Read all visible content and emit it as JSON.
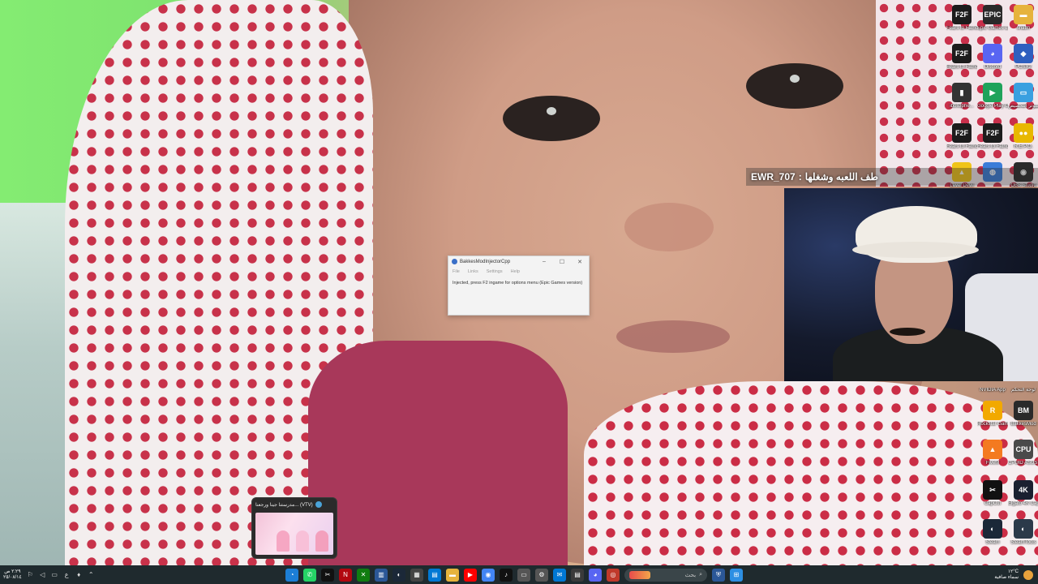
{
  "chat_overlay": {
    "username": "EWR_707",
    "separator": ":",
    "message": "طف اللعبه وشغلها"
  },
  "dialog": {
    "title": "BakkesModInjectorCpp",
    "minimize": "–",
    "maximize": "☐",
    "close": "✕",
    "menu": [
      "File",
      "Links",
      "Settings",
      "Help"
    ],
    "message": "Injected, press F2 ingame for options menu (Epic Games version)"
  },
  "taskbar_preview": {
    "title": "مدرستنا جينا ورجعنا... (VTV)"
  },
  "desktop_icons": [
    {
      "label": "Fears to Fathom...",
      "glyph": "F2F",
      "color": "#1c1c1c",
      "icon": "fears-to-fathom-icon"
    },
    {
      "label": "Epic Games Launcher",
      "glyph": "EPIC",
      "color": "#2a2a2a",
      "icon": "epic-games-icon"
    },
    {
      "label": "shatm",
      "glyph": "▬",
      "color": "#e6b33c",
      "icon": "folder-icon"
    },
    {
      "label": "Fears to Fathom...",
      "glyph": "F2F",
      "color": "#1c1c1c",
      "icon": "fears-to-fathom-icon"
    },
    {
      "label": "Discord",
      "glyph": "◕",
      "color": "#5865f2",
      "icon": "discord-icon"
    },
    {
      "label": "PCSX2",
      "glyph": "◆",
      "color": "#2f5fbf",
      "icon": "pcsx2-icon"
    },
    {
      "label": "ibbs3phe...",
      "glyph": "▮",
      "color": "#333333",
      "icon": "game-icon"
    },
    {
      "label": "Google Play Games",
      "glyph": "▶",
      "color": "#1fa35b",
      "icon": "google-play-games-icon"
    },
    {
      "label": "هذا الكمبيوتر التخصيص",
      "glyph": "▭",
      "color": "#3aa0e0",
      "icon": "this-pc-icon"
    },
    {
      "label": "Fears to Fathom...",
      "glyph": "F2F",
      "color": "#1c1c1c",
      "icon": "fears-to-fathom-icon"
    },
    {
      "label": "Fears to Fathom...",
      "glyph": "F2F",
      "color": "#1c1c1c",
      "icon": "fears-to-fathom-icon"
    },
    {
      "label": "R.E.P.O.",
      "glyph": "●●",
      "color": "#e8b800",
      "icon": "repo-icon"
    },
    {
      "label": "Level Devil",
      "glyph": "▲",
      "color": "#f0c419",
      "icon": "level-devil-icon"
    },
    {
      "label": "",
      "glyph": "◍",
      "color": "#3b7dd8",
      "icon": "app-icon"
    },
    {
      "label": "OBS Studio",
      "glyph": "◉",
      "color": "#2b2b2b",
      "icon": "obs-studio-icon"
    },
    {
      "label": "NVIDIA App",
      "glyph": "",
      "color": "transparent",
      "icon": "nvidia-icon"
    },
    {
      "label": "لوحة التحكم",
      "glyph": "",
      "color": "transparent",
      "icon": "control-panel-icon"
    },
    {
      "label": "Rockstar Games...",
      "glyph": "R",
      "color": "#f2a900",
      "icon": "rockstar-games-icon"
    },
    {
      "label": "BakkesMod",
      "glyph": "BM",
      "color": "#2a2a2a",
      "icon": "bakkesmod-icon"
    },
    {
      "label": "FiveM",
      "glyph": "▲",
      "color": "#f47a20",
      "icon": "fivem-icon"
    },
    {
      "label": "CPUID ASUS CPU-Z",
      "glyph": "CPU",
      "color": "#4a4a4a",
      "icon": "cpu-z-icon"
    },
    {
      "label": "CapCut",
      "glyph": "✂",
      "color": "#111111",
      "icon": "capcut-icon"
    },
    {
      "label": "Elgato 4K Captur...",
      "glyph": "4K",
      "color": "#1a2030",
      "icon": "elgato-icon"
    },
    {
      "label": "Steam",
      "glyph": "◐",
      "color": "#1b2838",
      "icon": "steam-icon"
    },
    {
      "label": "SteamTools",
      "glyph": "◐",
      "color": "#2b3a4a",
      "icon": "steamtools-icon"
    }
  ],
  "taskbar": {
    "clock_time": "٢:٢٩ ص",
    "clock_date": "٢٥/٠٨/١٤",
    "lang": "ع",
    "search_placeholder": "بحث",
    "weather_temp": "١٢°C",
    "weather_desc": "سماء صافية",
    "apps": [
      {
        "icon": "edge-icon",
        "glyph": "◔",
        "color": "#1c7ed6"
      },
      {
        "icon": "whatsapp-icon",
        "glyph": "✆",
        "color": "#25d366"
      },
      {
        "icon": "capcut-icon",
        "glyph": "✂",
        "color": "#111111"
      },
      {
        "icon": "netflix-icon",
        "glyph": "N",
        "color": "#b20710"
      },
      {
        "icon": "xbox-icon",
        "glyph": "✕",
        "color": "#107c10"
      },
      {
        "icon": "task-manager-icon",
        "glyph": "▥",
        "color": "#2b5797"
      },
      {
        "icon": "steam-icon",
        "glyph": "◐",
        "color": "#1b2838"
      },
      {
        "icon": "calculator-icon",
        "glyph": "▦",
        "color": "#444444"
      },
      {
        "icon": "calendar-icon",
        "glyph": "▤",
        "color": "#0078d4"
      },
      {
        "icon": "file-explorer-icon",
        "glyph": "▬",
        "color": "#e6b33c"
      },
      {
        "icon": "youtube-icon",
        "glyph": "▶",
        "color": "#ff0000"
      },
      {
        "icon": "chrome-icon",
        "glyph": "◉",
        "color": "#4285f4"
      },
      {
        "icon": "tiktok-icon",
        "glyph": "♪",
        "color": "#111111"
      },
      {
        "icon": "screen-icon",
        "glyph": "▭",
        "color": "#555555"
      },
      {
        "icon": "settings-icon",
        "glyph": "⚙",
        "color": "#555555"
      },
      {
        "icon": "mail-icon",
        "glyph": "✉",
        "color": "#0078d4"
      },
      {
        "icon": "notepad-icon",
        "glyph": "▤",
        "color": "#3a3a3a"
      },
      {
        "icon": "discord-icon",
        "glyph": "◕",
        "color": "#5865f2"
      },
      {
        "icon": "app-icon",
        "glyph": "◎",
        "color": "#c0392b"
      },
      {
        "icon": "shield-icon",
        "glyph": "⛨",
        "color": "#2b5797"
      }
    ]
  }
}
